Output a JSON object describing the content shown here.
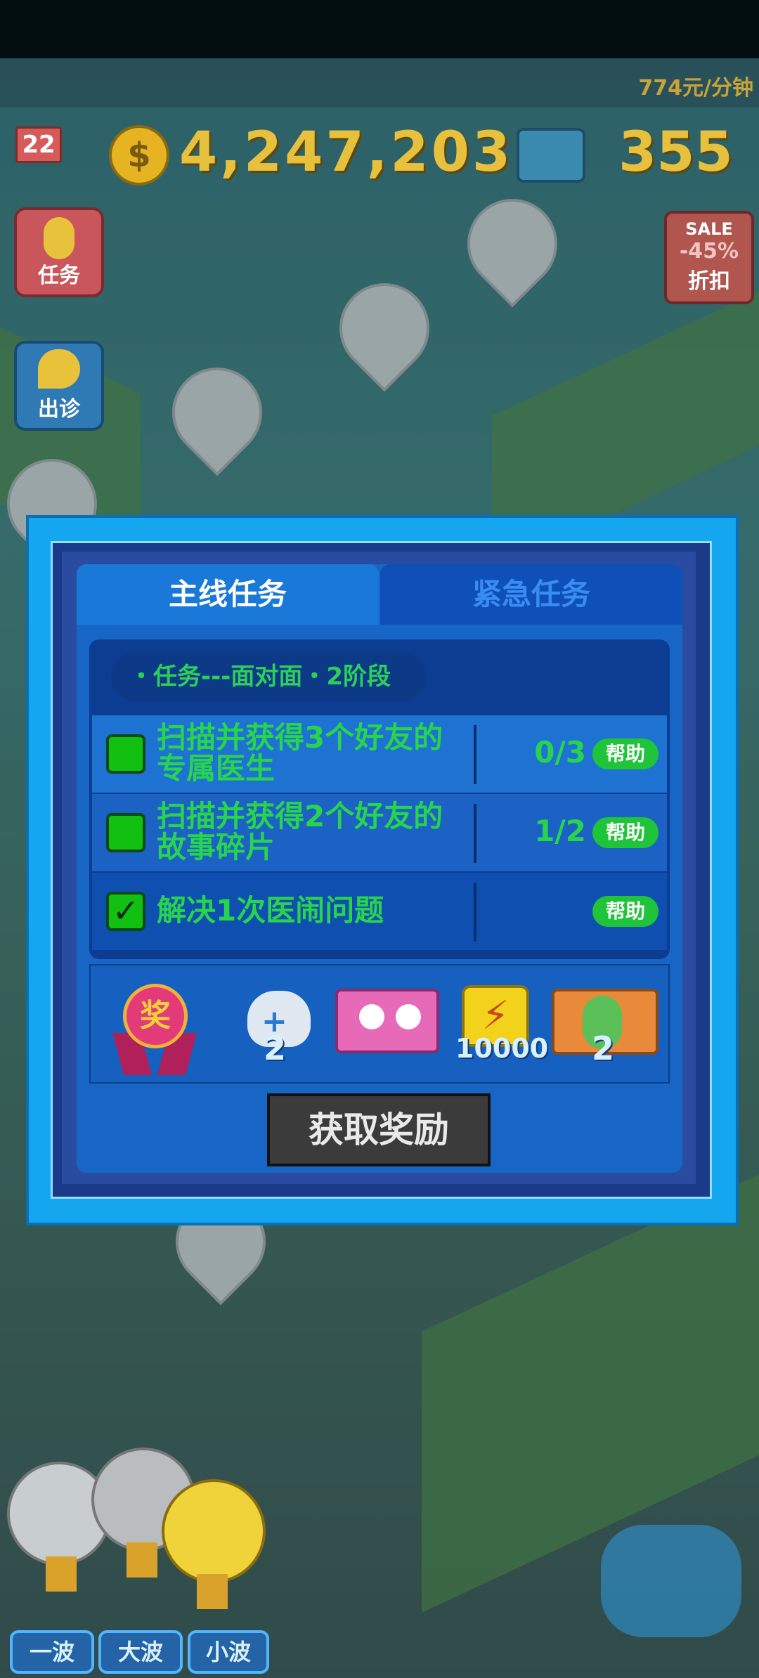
{
  "hud": {
    "income": "774元/分钟",
    "level": "22",
    "coin_symbol": "$",
    "money": "4,247,203",
    "gems": "355"
  },
  "side_buttons": {
    "task": "任务",
    "outcall": "出诊",
    "sale_tag": "SALE",
    "sale_percent": "-45%",
    "sale_label": "折扣"
  },
  "dialog": {
    "tabs": [
      {
        "label": "主线任务",
        "active": true
      },
      {
        "label": "紧急任务",
        "active": false
      }
    ],
    "subtitle": "・任务---面对面・2阶段",
    "tasks": [
      {
        "line1": "扫描并获得3个好友的",
        "line2": "专属医生",
        "progress": "0/3",
        "help": "帮助",
        "done": false
      },
      {
        "line1": "扫描并获得2个好友的",
        "line2": "故事碎片",
        "progress": "1/2",
        "help": "帮助",
        "done": false
      },
      {
        "line1": "解决1次医闹问题",
        "line2": "",
        "progress": "",
        "help": "帮助",
        "done": true
      }
    ],
    "reward_badge": "奖",
    "rewards": [
      {
        "icon": "cat-medkit-icon",
        "count": "2"
      },
      {
        "icon": "doctor-card-icon",
        "count": ""
      },
      {
        "icon": "lightning-icon",
        "count": "10000"
      },
      {
        "icon": "nurse-card-icon",
        "count": "2"
      }
    ],
    "claim_button": "获取奖励"
  },
  "wave_buttons": [
    "一波",
    "大波",
    "小波"
  ],
  "colors": {
    "dialog_frame": "#14a6ee",
    "panel": "#1766c6",
    "task_text": "#28d44e",
    "help_button": "#20c43a",
    "coin_text": "#e7c13d"
  }
}
